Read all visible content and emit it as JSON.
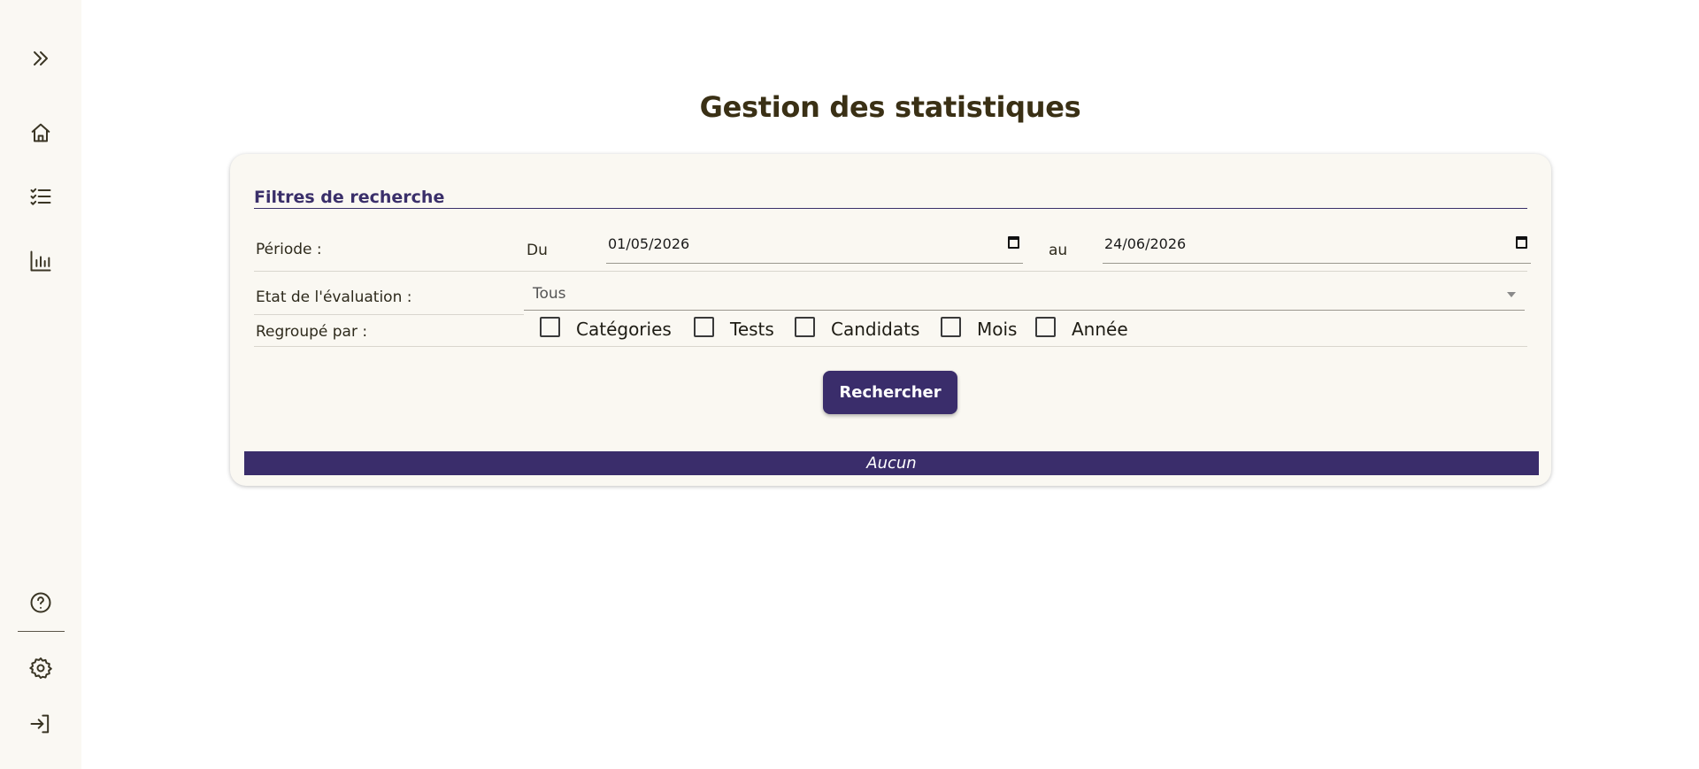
{
  "sidebar": {
    "expand": "chevrons-right-icon",
    "items": [
      "home-icon",
      "checklist-icon",
      "chart-icon"
    ],
    "bottom": [
      "help-icon",
      "settings-icon",
      "logout-icon"
    ]
  },
  "page": {
    "title": "Gestion des statistiques"
  },
  "filters": {
    "title": "Filtres de recherche",
    "period_label": "Période :",
    "from_label": "Du",
    "from_value": "01/05/2026",
    "to_label": "au",
    "to_value": "24/06/2026",
    "state_label": "Etat de l'évaluation :",
    "state_value": "Tous",
    "group_label": "Regroupé par :",
    "group_options": [
      "Catégories",
      "Tests",
      "Candidats",
      "Mois",
      "Année"
    ],
    "search_label": "Rechercher"
  },
  "result": {
    "text": "Aucun"
  },
  "colors": {
    "accent": "#3a2d6b",
    "sidebar_bg": "#faf8f3",
    "card_bg": "#faf8f2"
  }
}
